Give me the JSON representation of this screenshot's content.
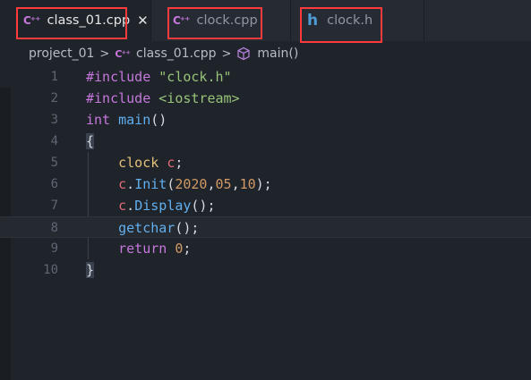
{
  "tabs": [
    {
      "label": "class_01.cpp",
      "icon": "cpp-icon",
      "icon_text": "C⁺⁺",
      "active": true,
      "close": "✕"
    },
    {
      "label": "clock.cpp",
      "icon": "cpp-icon",
      "icon_text": "C⁺⁺",
      "active": false
    },
    {
      "label": "clock.h",
      "icon": "header-icon",
      "icon_text": "h",
      "active": false
    }
  ],
  "breadcrumb": {
    "folder": "project_01",
    "file": "class_01.cpp",
    "file_icon_text": "C⁺⁺",
    "symbol": "main()"
  },
  "code_lines": [
    {
      "num": "1",
      "tokens": [
        [
          "kw-pre",
          "#include "
        ],
        [
          "str",
          "\"clock.h\""
        ]
      ]
    },
    {
      "num": "2",
      "tokens": [
        [
          "kw-pre",
          "#include "
        ],
        [
          "str",
          "<iostream>"
        ]
      ]
    },
    {
      "num": "3",
      "tokens": [
        [
          "type",
          "int "
        ],
        [
          "fn",
          "main"
        ],
        [
          "punct",
          "()"
        ]
      ]
    },
    {
      "num": "4",
      "tokens": [
        [
          "brace",
          "{"
        ]
      ]
    },
    {
      "num": "5",
      "tokens": [
        [
          "punct",
          "    "
        ],
        [
          "cls",
          "clock "
        ],
        [
          "var",
          "c"
        ],
        [
          "punct",
          ";"
        ]
      ]
    },
    {
      "num": "6",
      "tokens": [
        [
          "punct",
          "    "
        ],
        [
          "var",
          "c"
        ],
        [
          "punct",
          "."
        ],
        [
          "fn",
          "Init"
        ],
        [
          "punct",
          "("
        ],
        [
          "num",
          "2020"
        ],
        [
          "punct",
          ","
        ],
        [
          "num",
          "05"
        ],
        [
          "punct",
          ","
        ],
        [
          "num",
          "10"
        ],
        [
          "punct",
          ");"
        ]
      ]
    },
    {
      "num": "7",
      "tokens": [
        [
          "punct",
          "    "
        ],
        [
          "var",
          "c"
        ],
        [
          "punct",
          "."
        ],
        [
          "fn",
          "Display"
        ],
        [
          "punct",
          "();"
        ]
      ]
    },
    {
      "num": "8",
      "tokens": [
        [
          "punct",
          "    "
        ],
        [
          "fn",
          "getchar"
        ],
        [
          "punct",
          "();"
        ]
      ]
    },
    {
      "num": "9",
      "tokens": [
        [
          "punct",
          "    "
        ],
        [
          "kw",
          "return "
        ],
        [
          "num",
          "0"
        ],
        [
          "punct",
          ";"
        ]
      ]
    },
    {
      "num": "10",
      "tokens": [
        [
          "brace",
          "}"
        ]
      ]
    }
  ]
}
